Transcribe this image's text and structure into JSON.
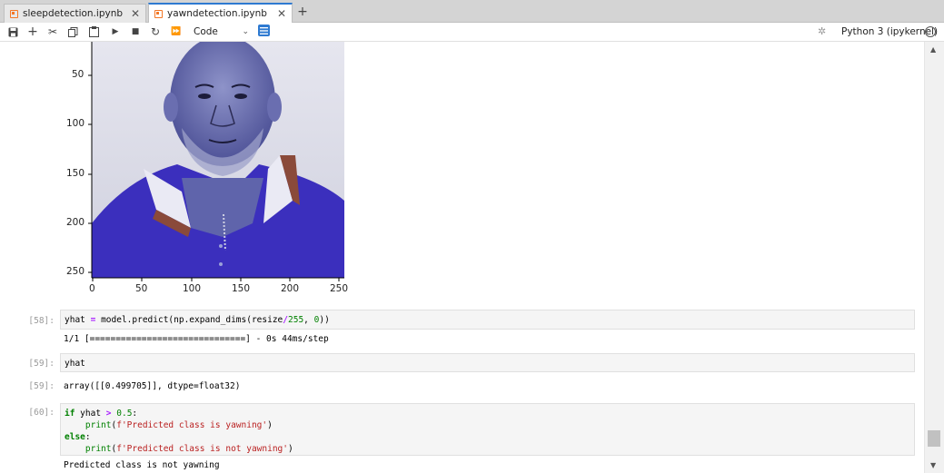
{
  "tabs": [
    {
      "label": "sleepdetection.ipynb",
      "active": false
    },
    {
      "label": "yawndetection.ipynb",
      "active": true
    }
  ],
  "toolbar": {
    "cell_type": "Code",
    "kernel": "Python 3 (ipykernel)"
  },
  "plot": {
    "y_ticks": [
      "50",
      "100",
      "150",
      "200",
      "250"
    ],
    "x_ticks": [
      "0",
      "50",
      "100",
      "150",
      "200",
      "250"
    ],
    "image_description_icon": "portrait-image"
  },
  "cells": [
    {
      "prompt": "[58]:",
      "code": "yhat = model.predict(np.expand_dims(resize/255, 0))",
      "output": "1/1 [==============================] - 0s 44ms/step"
    },
    {
      "prompt": "[59]:",
      "code": "yhat",
      "output_prompt": "[59]:",
      "output": "array([[0.499705]], dtype=float32)"
    },
    {
      "prompt": "[60]:",
      "code_lines": [
        "if yhat > 0.5:",
        "    print(f'Predicted class is yawning')",
        "else:",
        "    print(f'Predicted class is not yawning')"
      ],
      "output": "Predicted class is not yawning"
    }
  ],
  "colors": {
    "accent": "#2e7ad1",
    "notebook_icon": "#f37726"
  }
}
